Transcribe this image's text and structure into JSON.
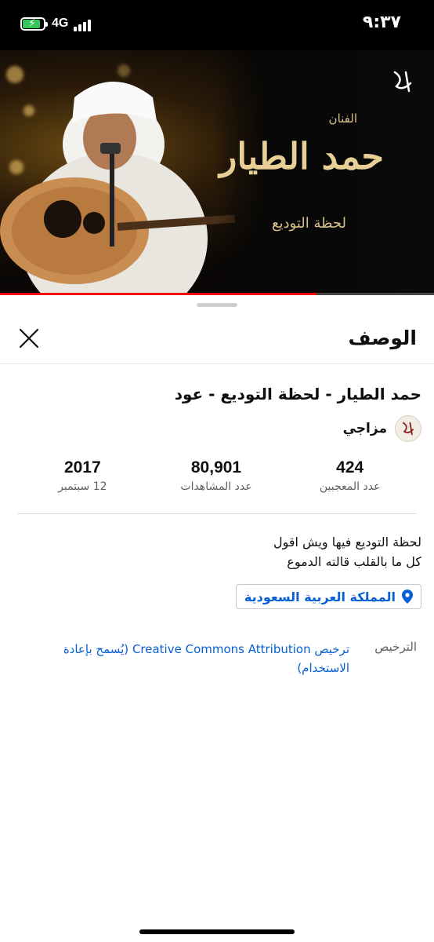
{
  "status_bar": {
    "time": "٩:٣٧",
    "network": "4G",
    "battery_level": 0.85,
    "battery_color": "#34c759"
  },
  "video": {
    "artist_label": "الفنان",
    "artist_name": "حمد الطيار",
    "album_name": "لحظة التوديع",
    "progress": 0.73,
    "progress_color": "#ff0000"
  },
  "sheet": {
    "title": "الوصف",
    "close_icon": "close-icon",
    "video_title": "حمد الطيار  - لحظة التوديع  - عود",
    "channel": {
      "name": "مزاجي",
      "avatar_icon": "channel-logo-icon"
    },
    "stats": [
      {
        "value": "424",
        "label": "عدد المعجبين"
      },
      {
        "value": "80,901",
        "label": "عدد المشاهدات"
      },
      {
        "value": "2017",
        "label": "12 سبتمبر"
      }
    ],
    "description_lines": [
      "لحظة التوديع فيها ويش اقول",
      "كل ما بالقلب قالته الدموع"
    ],
    "location": {
      "text": "المملكة العربية السعودية",
      "icon": "location-pin-icon",
      "color": "#065fd4"
    },
    "license": {
      "label": "الترخيص",
      "value": "ترخيص Creative Commons Attribution (يُسمح بإعادة الاستخدام)"
    }
  }
}
